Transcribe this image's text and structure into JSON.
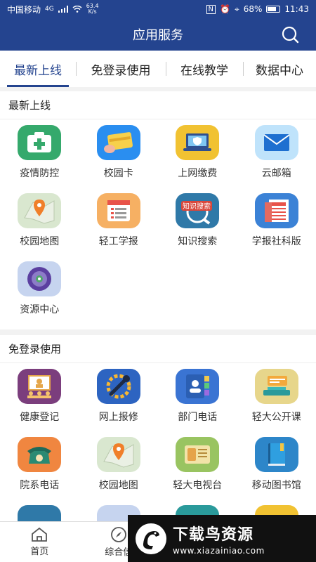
{
  "status_bar": {
    "carrier": "中国移动",
    "network": "4G",
    "speed_value": "63.4",
    "speed_unit": "K/s",
    "battery": "68%",
    "time": "11:43"
  },
  "header": {
    "title": "应用服务"
  },
  "tabs": [
    {
      "label": "最新上线",
      "active": true
    },
    {
      "label": "免登录使用",
      "active": false
    },
    {
      "label": "在线教学",
      "active": false
    },
    {
      "label": "数据中心",
      "active": false
    }
  ],
  "sections": [
    {
      "title": "最新上线",
      "items": [
        {
          "label": "疫情防控",
          "icon": "medical-kit-icon",
          "color": "#35a96c"
        },
        {
          "label": "校园卡",
          "icon": "card-icon",
          "color": "#2a8ef0"
        },
        {
          "label": "上网缴费",
          "icon": "laptop-shield-icon",
          "color": "#f1c232"
        },
        {
          "label": "云邮箱",
          "icon": "mail-icon",
          "color": "#bfe3fb"
        },
        {
          "label": "校园地图",
          "icon": "map-pin-icon",
          "color": "#d9e7cf"
        },
        {
          "label": "轻工学报",
          "icon": "document-list-icon",
          "color": "#f6b063"
        },
        {
          "label": "知识搜索",
          "icon": "knowledge-search-icon",
          "color": "#2f79a8"
        },
        {
          "label": "学报社科版",
          "icon": "newspaper-icon",
          "color": "#3b82d6"
        },
        {
          "label": "资源中心",
          "icon": "disc-icon",
          "color": "#c6d4ef"
        }
      ]
    },
    {
      "title": "免登录使用",
      "items": [
        {
          "label": "健康登记",
          "icon": "presentation-icon",
          "color": "#7b3e7d"
        },
        {
          "label": "网上报修",
          "icon": "repair-wrench-icon",
          "color": "#2d64c1"
        },
        {
          "label": "部门电话",
          "icon": "contacts-book-icon",
          "color": "#3a74d3"
        },
        {
          "label": "轻大公开课",
          "icon": "open-course-icon",
          "color": "#e7d68b"
        },
        {
          "label": "院系电话",
          "icon": "telephone-icon",
          "color": "#f08640"
        },
        {
          "label": "校园地图",
          "icon": "map-pin-icon",
          "color": "#d9e7cf"
        },
        {
          "label": "轻大电视台",
          "icon": "tv-station-icon",
          "color": "#99c461"
        },
        {
          "label": "移动图书馆",
          "icon": "book-icon",
          "color": "#2d86c9"
        }
      ]
    }
  ],
  "bottom_nav": [
    {
      "label": "首页",
      "icon": "home-icon"
    },
    {
      "label": "综合信",
      "icon": "compass-icon"
    }
  ],
  "watermark": {
    "title": "下载鸟资源",
    "url": "www.xiazainiao.com"
  }
}
